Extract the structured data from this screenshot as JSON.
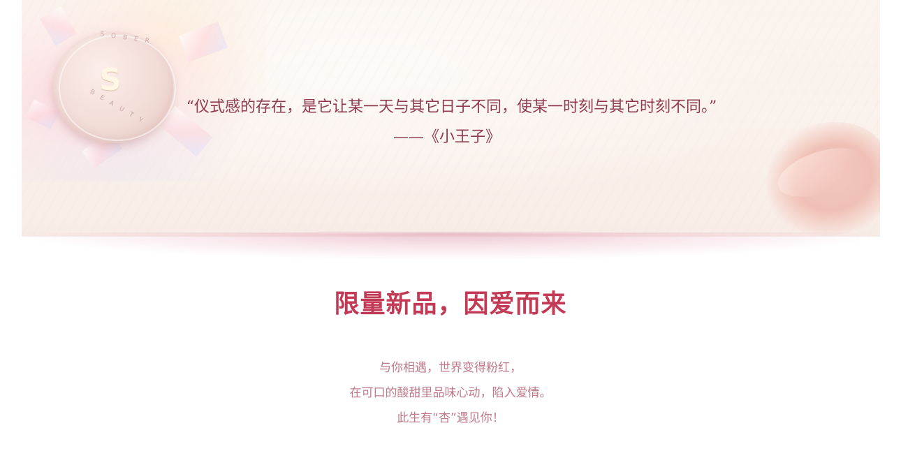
{
  "hero": {
    "quote": "“仪式感的存在，是它让某一天与其它日子不同，使某一时刻与其它时刻不同。”",
    "quote_author": "——《小王子》",
    "product": {
      "brand_top": "SOBER",
      "brand_bottom": "BEAUTY",
      "logo_glyph": "S"
    }
  },
  "section": {
    "title": "限量新品，因爱而来",
    "description": [
      "与你相遇，世界变得粉红，",
      "在可口的酸甜里品味心动，陷入爱情。",
      "此生有“杏”遇见你！"
    ]
  },
  "colors": {
    "title": "#c23a55",
    "quote": "#8f3b4d",
    "description": "#c07a8a",
    "banner_bg": "#faf1eb"
  }
}
